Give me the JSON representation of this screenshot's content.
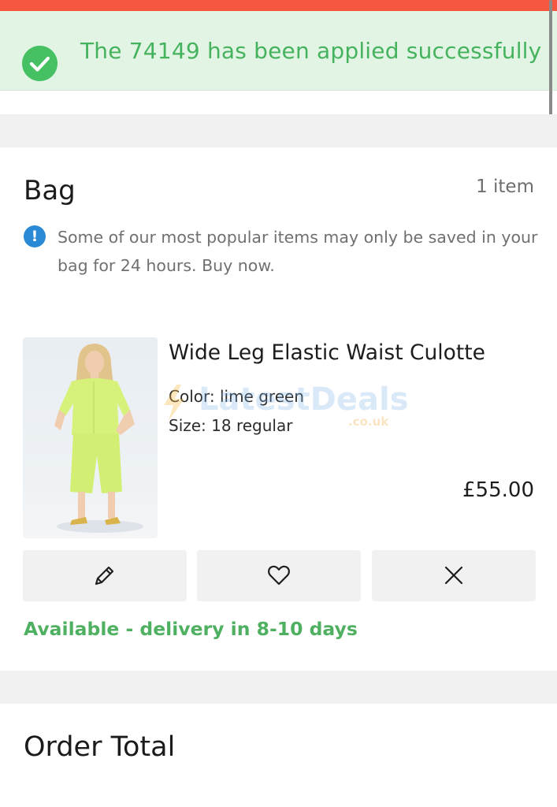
{
  "toast": {
    "icon": "check-circle-icon",
    "message": "The 74149 has been applied successfully",
    "color": "#45b35e"
  },
  "bag": {
    "title": "Bag",
    "item_count": "1 item",
    "notice_icon": "info-icon",
    "notice_icon_glyph": "!",
    "notice": "Some of our most popular items may only be saved in your bag for 24 hours. Buy now."
  },
  "product": {
    "name": "Wide Leg Elastic Waist Culotte",
    "color_line": "Color: lime green",
    "size_line": "Size: 18 regular",
    "price": "£55.00",
    "availability": "Available - delivery in 8-10 days",
    "actions": [
      {
        "icon": "pencil-icon"
      },
      {
        "icon": "heart-icon"
      },
      {
        "icon": "close-icon"
      }
    ]
  },
  "watermark": {
    "brand": "LatestDeals",
    "domain": ".co.uk"
  },
  "order_total": {
    "title": "Order Total"
  },
  "colors": {
    "top_bar": "#f5583f",
    "toast_bg": "#e2f4e4",
    "success_green": "#45c063",
    "availability_green": "#4fb062",
    "info_blue": "#2a8ad6",
    "band_gray": "#f1f1f1"
  }
}
